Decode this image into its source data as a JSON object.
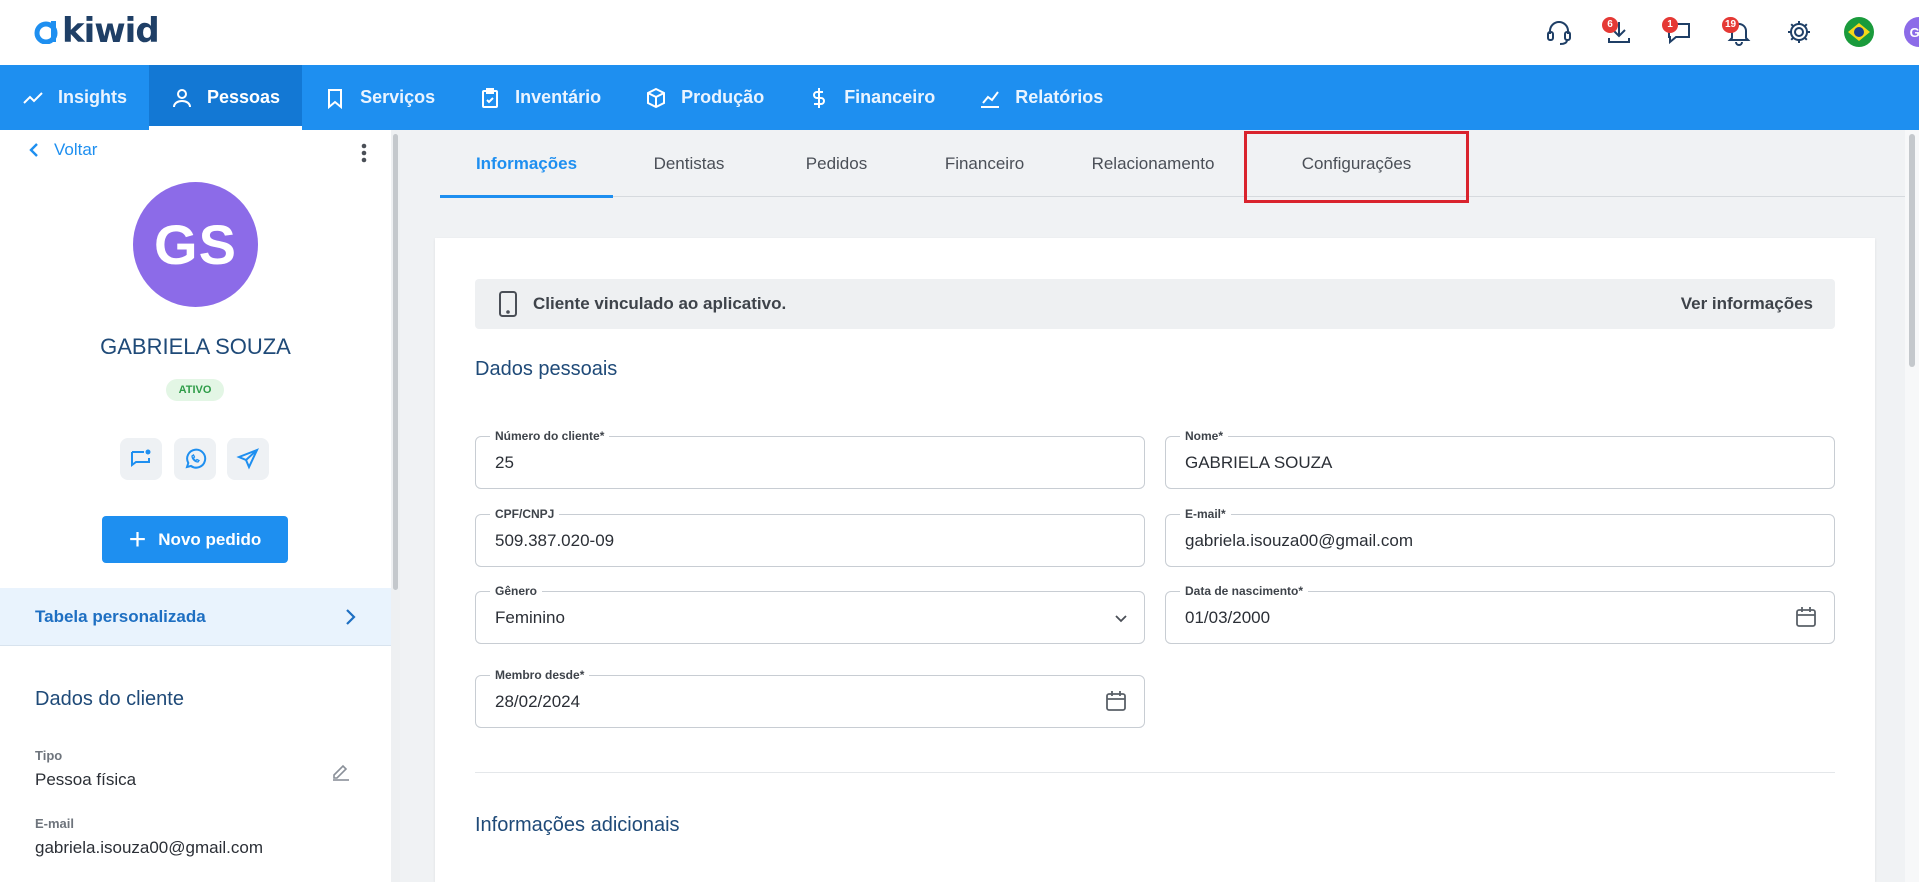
{
  "brand": {
    "name": "kiwid",
    "primary_color": "#1e8ff0",
    "dark_color": "#1f3f66"
  },
  "header": {
    "icons": [
      {
        "name": "support-icon",
        "badge": ""
      },
      {
        "name": "download-icon",
        "badge": "6"
      },
      {
        "name": "chat-icon",
        "badge": "1"
      },
      {
        "name": "bell-icon",
        "badge": "19"
      },
      {
        "name": "gear-icon",
        "badge": ""
      },
      {
        "name": "brazil-flag-icon",
        "badge": ""
      }
    ],
    "user_initials": "GS"
  },
  "nav": {
    "items": [
      {
        "label": "Insights",
        "icon": "trend-icon"
      },
      {
        "label": "Pessoas",
        "icon": "person-icon",
        "active": true
      },
      {
        "label": "Serviços",
        "icon": "tooth-icon"
      },
      {
        "label": "Inventário",
        "icon": "clipboard-icon"
      },
      {
        "label": "Produção",
        "icon": "box-icon"
      },
      {
        "label": "Financeiro",
        "icon": "dollar-icon"
      },
      {
        "label": "Relatórios",
        "icon": "chart-icon"
      }
    ]
  },
  "sidebar": {
    "back_label": "Voltar",
    "avatar_initials": "GS",
    "name": "GABRIELA SOUZA",
    "status": "ATIVO",
    "new_order_label": "Novo pedido",
    "custom_table_label": "Tabela personalizada",
    "section_title": "Dados do cliente",
    "fields": [
      {
        "label": "Tipo",
        "value": "Pessoa física"
      },
      {
        "label": "E-mail",
        "value": "gabriela.isouza00@gmail.com"
      }
    ]
  },
  "tabs": [
    {
      "label": "Informações",
      "active": true
    },
    {
      "label": "Dentistas"
    },
    {
      "label": "Pedidos"
    },
    {
      "label": "Financeiro"
    },
    {
      "label": "Relacionamento"
    },
    {
      "label": "Configurações",
      "highlighted": true
    }
  ],
  "main": {
    "app_banner": {
      "text": "Cliente vinculado ao aplicativo.",
      "link": "Ver informações"
    },
    "personal_title": "Dados pessoais",
    "form": {
      "client_number": {
        "label": "Número do cliente",
        "required": "*",
        "value": "25"
      },
      "name": {
        "label": "Nome",
        "required": "*",
        "value": "GABRIELA SOUZA"
      },
      "document": {
        "label": "CPF/CNPJ",
        "value": "509.387.020-09"
      },
      "email": {
        "label": "E-mail",
        "required": "*",
        "value": "gabriela.isouza00@gmail.com"
      },
      "gender": {
        "label": "Gênero",
        "value": "Feminino"
      },
      "birth_date": {
        "label": "Data de nascimento",
        "required": "*",
        "value": "01/03/2000"
      },
      "member_since": {
        "label": "Membro desde",
        "required": "*",
        "value": "28/02/2024"
      }
    },
    "additional_title": "Informações adicionais"
  }
}
